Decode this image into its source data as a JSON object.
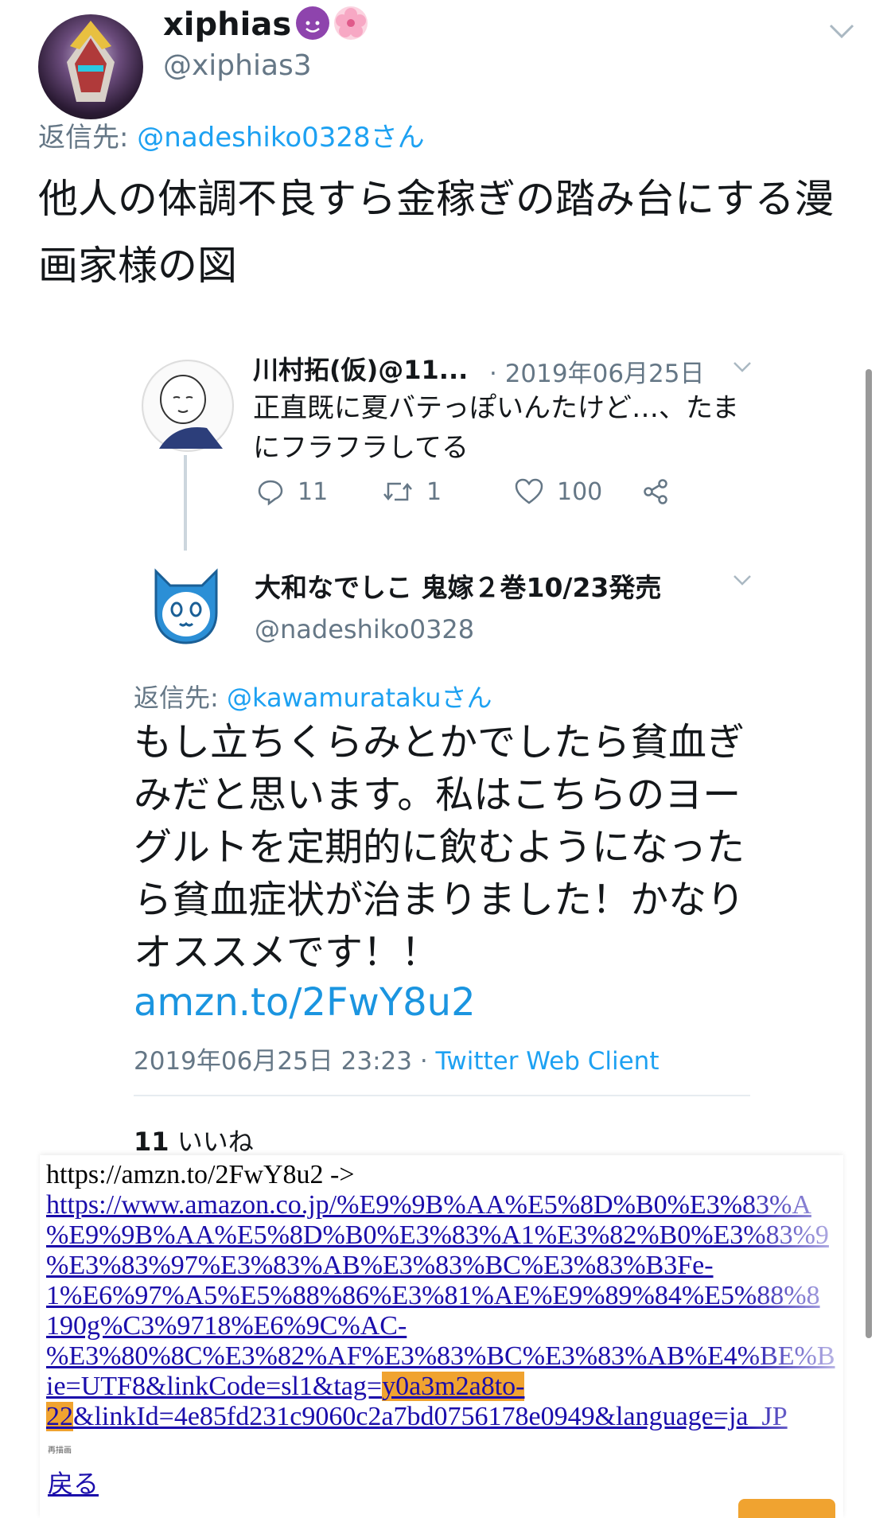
{
  "tweet": {
    "display_name": "xiphias",
    "emoji_icons": [
      "smiling-devil-icon",
      "cherry-blossom-icon"
    ],
    "handle": "@xiphias3",
    "reply_prefix": "返信先: ",
    "reply_mention": "@nadeshiko0328さん",
    "text": "他人の体調不良すら金稼ぎの踏み台にする漫画家様の図"
  },
  "embedded": {
    "tweet1": {
      "name": "川村拓(仮)@11...",
      "date": "· 2019年06月25日",
      "text": "正直既に夏バテっぽいんたけど…、たまにフラフラしてる",
      "replies": "11",
      "retweets": "1",
      "likes": "100"
    },
    "tweet2": {
      "name": "大和なでしこ 鬼嫁２巻10/23発売",
      "handle": "@nadeshiko0328",
      "reply_prefix": "返信先: ",
      "reply_mention": "@kawamuratakuさん",
      "text": "もし立ちくらみとかでしたら貧血ぎみだと思います。私はこちらのヨーグルトを定期的に飲むようになったら貧血症状が治まりました！かなりオススメです！！",
      "link": "amzn.to/2FwY8u2",
      "timestamp": "2019年06月25日 23:23 · ",
      "client": "Twitter Web Client",
      "likes_count": "11",
      "likes_label": "いいね"
    }
  },
  "overlay": {
    "first_line": "https://amzn.to/2FwY8u2 ->",
    "link_lines": [
      "https://www.amazon.co.jp/%E9%9B%AA%E5%8D%B0%E3%83%A",
      "%E9%9B%AA%E5%8D%B0%E3%83%A1%E3%82%B0%E3%83%9",
      "%E3%83%97%E3%83%AB%E3%83%BC%E3%83%B3Fe-",
      "1%E6%97%A5%E5%88%86%E3%81%AE%E9%89%84%E5%88%8",
      "190g%C3%9718%E6%9C%AC-",
      "%E3%80%8C%E3%82%AF%E3%83%BC%E3%83%AB%E4%BE%B",
      "ie=UTF8&linkCode=sl1&tag="
    ],
    "tag_part1": "y0a3m2a8to-",
    "tag_part2": "22",
    "last_line_rest": "&linkId=4e85fd231c9060c2a7bd0756178e0949&language=ja_JP",
    "small_label": "再描画",
    "back_label": "戻る"
  }
}
